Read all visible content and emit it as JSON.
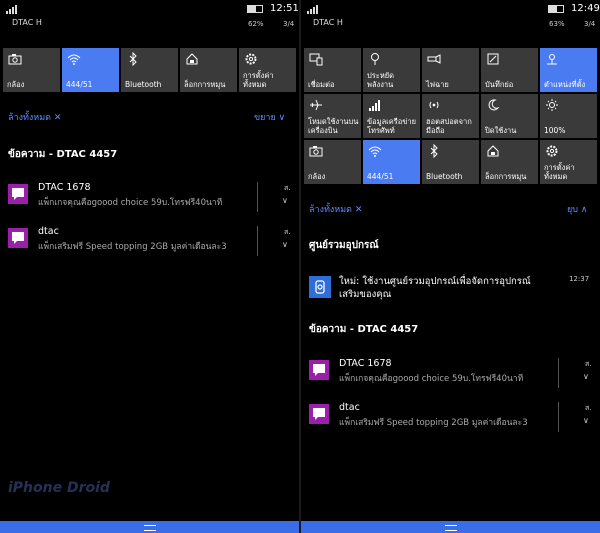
{
  "left": {
    "status": {
      "carrier": "DTAC H",
      "battery_pct": "62%",
      "time": "12:51",
      "page": "3/4"
    },
    "tiles": [
      {
        "label": "กล้อง",
        "icon": "camera-icon",
        "on": false
      },
      {
        "label": "444/51",
        "icon": "wifi-icon",
        "on": true
      },
      {
        "label": "Bluetooth",
        "icon": "bluetooth-icon",
        "on": false
      },
      {
        "label": "ล็อกการหมุน",
        "icon": "rotation-lock-icon",
        "on": false
      },
      {
        "label": "การตั้งค่าทั้งหมด",
        "icon": "gear-icon",
        "on": false
      }
    ],
    "clear_all": "ล้างทั้งหมด ✕",
    "expand": "ขยาย ∨",
    "section_messages": "ข้อความ - DTAC 4457",
    "notifications": [
      {
        "title": "DTAC 1678",
        "body": "แพ็กเกจคุณคือgoood choice 59บ.โทรฟรี40นาที",
        "time": "ส."
      },
      {
        "title": "dtac",
        "body": "แพ็กเสริมฟรี Speed topping 2GB มูลค่าเดือนละ3",
        "time": "ส."
      }
    ],
    "watermark": "iPhone Droid"
  },
  "right": {
    "status": {
      "carrier": "DTAC H",
      "battery_pct": "63%",
      "time": "12:49",
      "page": "3/4"
    },
    "tiles": [
      {
        "label": "เชื่อมต่อ",
        "icon": "connect-icon",
        "on": false
      },
      {
        "label": "ประหยัดพลังงาน",
        "icon": "battery-saver-icon",
        "on": false
      },
      {
        "label": "ไฟฉาย",
        "icon": "flashlight-icon",
        "on": false
      },
      {
        "label": "บันทึกย่อ",
        "icon": "note-icon",
        "on": false
      },
      {
        "label": "ตำแหน่งที่ตั้ง",
        "icon": "location-icon",
        "on": true
      },
      {
        "label": "โหมดใช้งานบนเครื่องบิน",
        "icon": "airplane-icon",
        "on": false
      },
      {
        "label": "ข้อมูลเครือข่ายโทรศัพท์",
        "icon": "cellular-icon",
        "on": false
      },
      {
        "label": "ฮอตสปอตจากมือถือ",
        "icon": "hotspot-icon",
        "on": false
      },
      {
        "label": "ปิดใช้งาน",
        "icon": "moon-icon",
        "on": false
      },
      {
        "label": "100%",
        "icon": "brightness-icon",
        "on": false
      },
      {
        "label": "กล้อง",
        "icon": "camera-icon",
        "on": false
      },
      {
        "label": "444/51",
        "icon": "wifi-icon",
        "on": true
      },
      {
        "label": "Bluetooth",
        "icon": "bluetooth-icon",
        "on": false
      },
      {
        "label": "ล็อกการหมุน",
        "icon": "rotation-lock-icon",
        "on": false
      },
      {
        "label": "การตั้งค่าทั้งหมด",
        "icon": "gear-icon",
        "on": false
      }
    ],
    "clear_all": "ล้างทั้งหมด ✕",
    "collapse": "ยุบ ∧",
    "section_device": "ศูนย์รวมอุปกรณ์",
    "device_notif": {
      "title": "ใหม่: ใช้งานศูนย์รวมอุปกรณ์เพื่อจัดการอุปกรณ์",
      "title2": "เสริมของคุณ",
      "time": "12:37"
    },
    "section_messages": "ข้อความ - DTAC 4457",
    "notifications": [
      {
        "title": "DTAC 1678",
        "body": "แพ็กเกจคุณคือgoood choice 59บ.โทรฟรี40นาที",
        "time": "ส."
      },
      {
        "title": "dtac",
        "body": "แพ็กเสริมฟรี Speed topping 2GB มูลค่าเดือนละ3",
        "time": "ส."
      }
    ]
  },
  "colors": {
    "accent": "#4a7bf0",
    "tile": "#3a3a3a",
    "link": "#5a8cff",
    "sms": "#9b1faa"
  }
}
